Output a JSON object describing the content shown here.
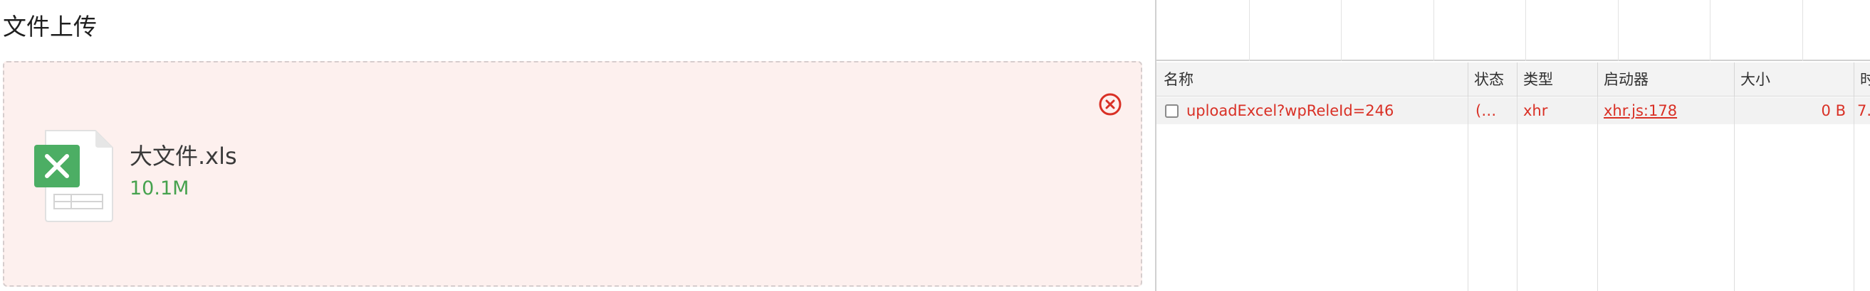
{
  "upload": {
    "title": "文件上传",
    "file": {
      "name": "大文件.xls",
      "size": "10.1M",
      "icon": "excel-file-icon"
    },
    "remove_icon": "close-circle-icon",
    "colors": {
      "panel_bg": "#fdf0ee",
      "size_text": "#46a24e",
      "remove": "#d93025",
      "excel_green": "#4cae64"
    }
  },
  "network": {
    "columns": [
      "名称",
      "状态",
      "类型",
      "启动器",
      "大小",
      "时"
    ],
    "rows": [
      {
        "name": "uploadExcel?wpReleId=246",
        "status": "(…",
        "type": "xhr",
        "initiator": "xhr.js:178",
        "size": "0 B",
        "time": "7."
      }
    ],
    "colors": {
      "error_text": "#d93025"
    }
  }
}
